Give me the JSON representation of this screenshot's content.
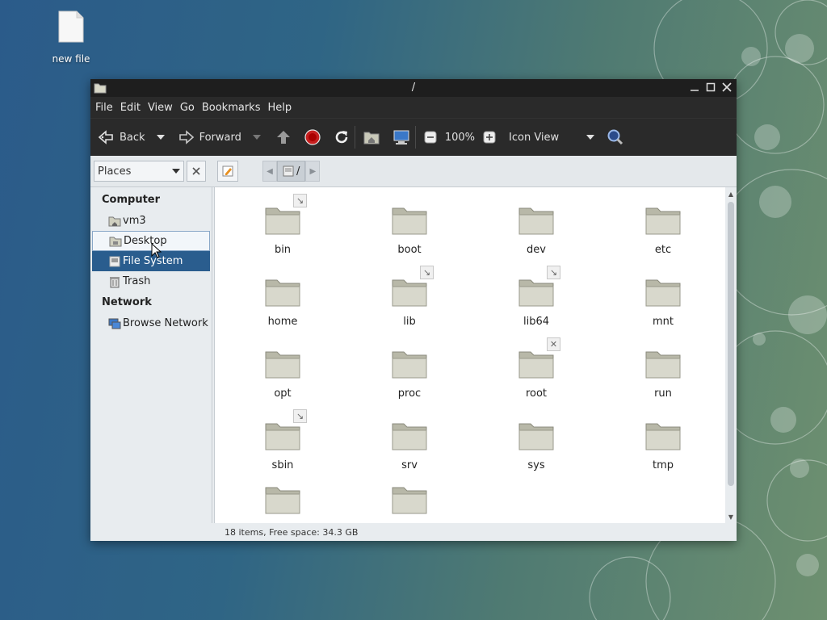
{
  "desktop": {
    "icon_label": "new file"
  },
  "window": {
    "title": "/"
  },
  "menu": [
    "File",
    "Edit",
    "View",
    "Go",
    "Bookmarks",
    "Help"
  ],
  "toolbar": {
    "back": "Back",
    "forward": "Forward",
    "zoom": "100%",
    "view_mode": "Icon View"
  },
  "location": {
    "places_label": "Places",
    "path": "/"
  },
  "sidebar": {
    "computer_header": "Computer",
    "computer_items": [
      {
        "label": "vm3",
        "icon": "home-folder-icon"
      },
      {
        "label": "Desktop",
        "icon": "desktop-folder-icon"
      },
      {
        "label": "File System",
        "icon": "drive-icon"
      },
      {
        "label": "Trash",
        "icon": "trash-icon"
      }
    ],
    "network_header": "Network",
    "network_items": [
      {
        "label": "Browse Network",
        "icon": "network-icon"
      }
    ]
  },
  "folders": [
    {
      "name": "bin",
      "emblem": "symlink"
    },
    {
      "name": "boot",
      "emblem": ""
    },
    {
      "name": "dev",
      "emblem": ""
    },
    {
      "name": "etc",
      "emblem": ""
    },
    {
      "name": "home",
      "emblem": ""
    },
    {
      "name": "lib",
      "emblem": "symlink"
    },
    {
      "name": "lib64",
      "emblem": "symlink"
    },
    {
      "name": "mnt",
      "emblem": ""
    },
    {
      "name": "opt",
      "emblem": ""
    },
    {
      "name": "proc",
      "emblem": ""
    },
    {
      "name": "root",
      "emblem": "locked"
    },
    {
      "name": "run",
      "emblem": ""
    },
    {
      "name": "sbin",
      "emblem": "symlink"
    },
    {
      "name": "srv",
      "emblem": ""
    },
    {
      "name": "sys",
      "emblem": ""
    },
    {
      "name": "tmp",
      "emblem": ""
    },
    {
      "name": "",
      "emblem": ""
    },
    {
      "name": "",
      "emblem": ""
    }
  ],
  "status": {
    "text": "18 items, Free space: 34.3 GB"
  },
  "colors": {
    "selection": "#2a5d8e",
    "toolbar_bg": "#2a2a2a"
  }
}
